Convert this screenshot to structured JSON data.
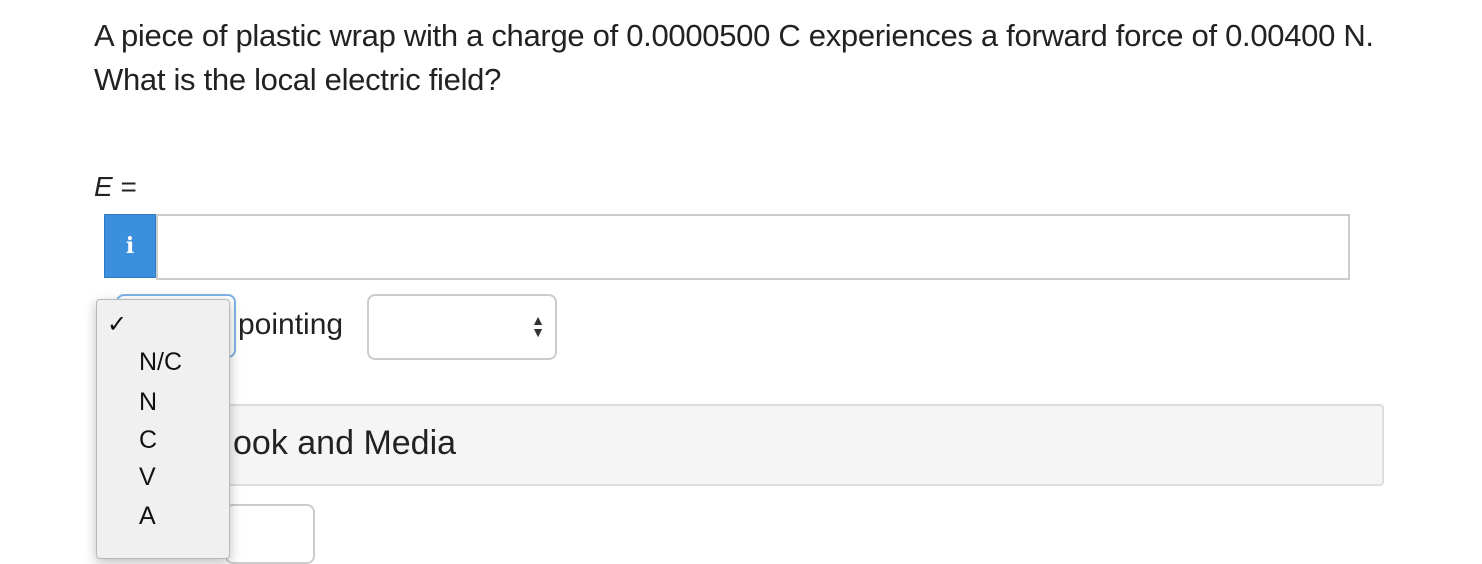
{
  "question": {
    "text": "A piece of plastic wrap with a charge of 0.0000500 C experiences a forward force of 0.00400 N. What is the local electric field?"
  },
  "answer": {
    "variable": "E",
    "equals": "=",
    "info_icon": "i",
    "value": "",
    "unit_selected": "",
    "pointing_label": "pointing",
    "direction_selected": ""
  },
  "unit_dropdown": {
    "checkmark_icon": "✓",
    "options": [
      "N/C",
      "N",
      "C",
      "V",
      "A"
    ]
  },
  "panel": {
    "title_visible": "ook and Media"
  },
  "colors": {
    "info_button": "#3b8fdd",
    "select_focus": "#7fb3e6",
    "panel_bg": "#f5f5f5"
  }
}
